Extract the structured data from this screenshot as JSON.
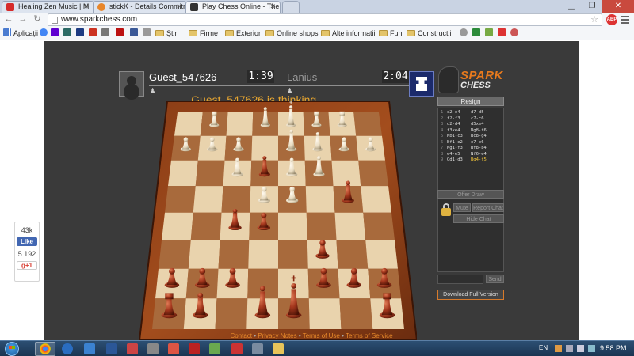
{
  "browser": {
    "tabs": [
      {
        "title": "Healing Zen Music | M",
        "favicon_color": "#d62b2b"
      },
      {
        "title": "stickK - Details Commitm",
        "favicon_color": "#e8862a"
      },
      {
        "title": "Play Chess Online - The P",
        "favicon_color": "#333333"
      }
    ],
    "url": "www.sparkchess.com",
    "bookmarks": [
      {
        "label": "Aplicații",
        "icon": "apps-icon"
      },
      {
        "label": "Știri",
        "icon": "folder-icon"
      },
      {
        "label": "Firme",
        "icon": "folder-icon"
      },
      {
        "label": "Exterior",
        "icon": "folder-icon"
      },
      {
        "label": "Online shops",
        "icon": "folder-icon"
      },
      {
        "label": "Alte informatii",
        "icon": "folder-icon"
      },
      {
        "label": "Fun",
        "icon": "folder-icon"
      },
      {
        "label": "Constructii",
        "icon": "folder-icon"
      }
    ],
    "adblock_label": "ABP"
  },
  "social": {
    "likes": "43k",
    "fb_label": "Like",
    "count": "5.192",
    "gplus_label": "g+1"
  },
  "game": {
    "player1": {
      "name": "Guest_547626",
      "clock": "1:39"
    },
    "player2": {
      "name": "Lanius",
      "clock": "2:04"
    },
    "logo_top": "SPARK",
    "logo_bottom": "CHESS",
    "status": "Guest_547626 is thinking...",
    "resign_label": "Resign",
    "moves": [
      {
        "n": "1",
        "w": "e2-e4",
        "b": "d7-d5"
      },
      {
        "n": "2",
        "w": "f2-f3",
        "b": "c7-c6"
      },
      {
        "n": "3",
        "w": "d2-d4",
        "b": "d5xe4"
      },
      {
        "n": "4",
        "w": "f3xe4",
        "b": "Ng8-f6"
      },
      {
        "n": "5",
        "w": "Nb1-c3",
        "b": "Bc8-g4"
      },
      {
        "n": "6",
        "w": "Bf1-e2",
        "b": "e7-e6"
      },
      {
        "n": "7",
        "w": "Ng1-f3",
        "b": "Bf8-b4"
      },
      {
        "n": "8",
        "w": "e4-e5",
        "b": "Nf6-e4"
      },
      {
        "n": "9",
        "w": "Qd1-d3",
        "b": "Bg4-f5"
      }
    ],
    "offer_draw_label": "Offer Draw",
    "mute_label": "Mute",
    "report_label": "Report Chat",
    "hide_chat_label": "Hide Chat",
    "send_label": "Send",
    "download_label": "Download Full Version"
  },
  "footer": {
    "contact": "Contact",
    "sep": " • ",
    "privacy": "Privacy Notes",
    "terms_use": "Terms of Use",
    "terms_service": "Terms of Service"
  },
  "taskbar": {
    "lang": "EN",
    "time": "9:58 PM"
  }
}
